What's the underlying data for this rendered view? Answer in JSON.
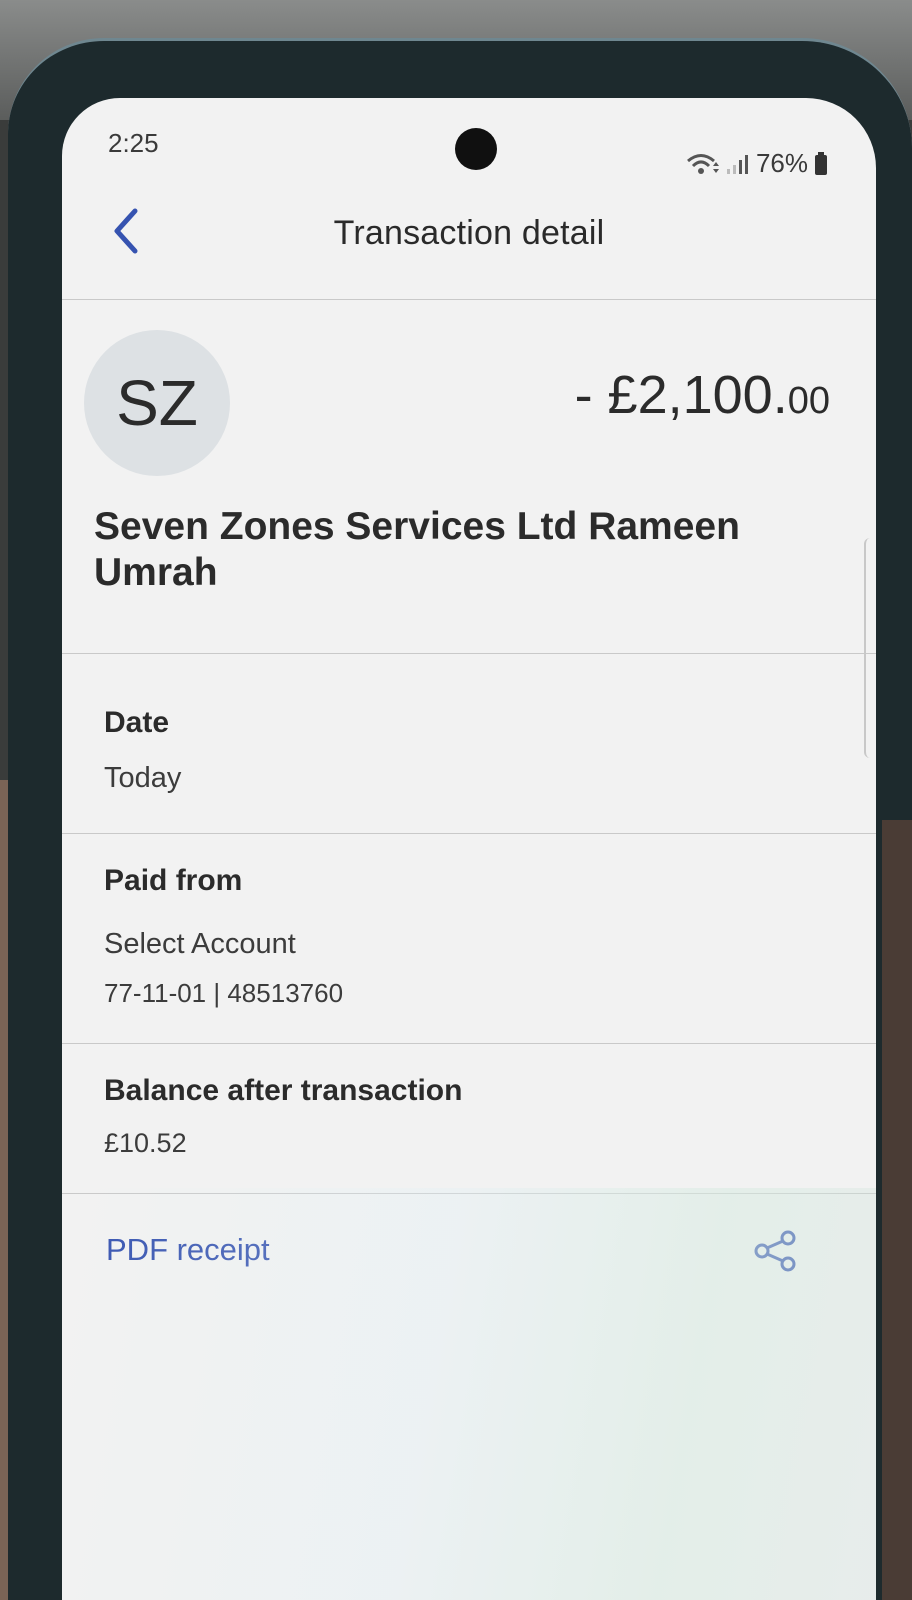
{
  "status_bar": {
    "time": "2:25",
    "battery": "76%",
    "icons": [
      "wifi-icon",
      "signal-icon",
      "battery-icon"
    ]
  },
  "header": {
    "back_icon": "chevron-left-icon",
    "title": "Transaction detail"
  },
  "summary": {
    "avatar_initials": "SZ",
    "amount_main": "- £2,100.",
    "amount_pence": "00",
    "payee": "Seven Zones Services Ltd Rameen Umrah"
  },
  "details": {
    "date_label": "Date",
    "date_value": "Today",
    "paid_from_label": "Paid from",
    "paid_from_account": "Select Account",
    "paid_from_number": "77-11-01 | 48513760",
    "balance_label": "Balance after transaction",
    "balance_value": "£10.52"
  },
  "receipt": {
    "link_label": "PDF receipt",
    "share_icon": "share-icon"
  },
  "colors": {
    "link": "#3653b0",
    "back_chevron": "#3653b0",
    "avatar_bg": "#dde1e4",
    "screen_bg": "#f2f2f2"
  }
}
